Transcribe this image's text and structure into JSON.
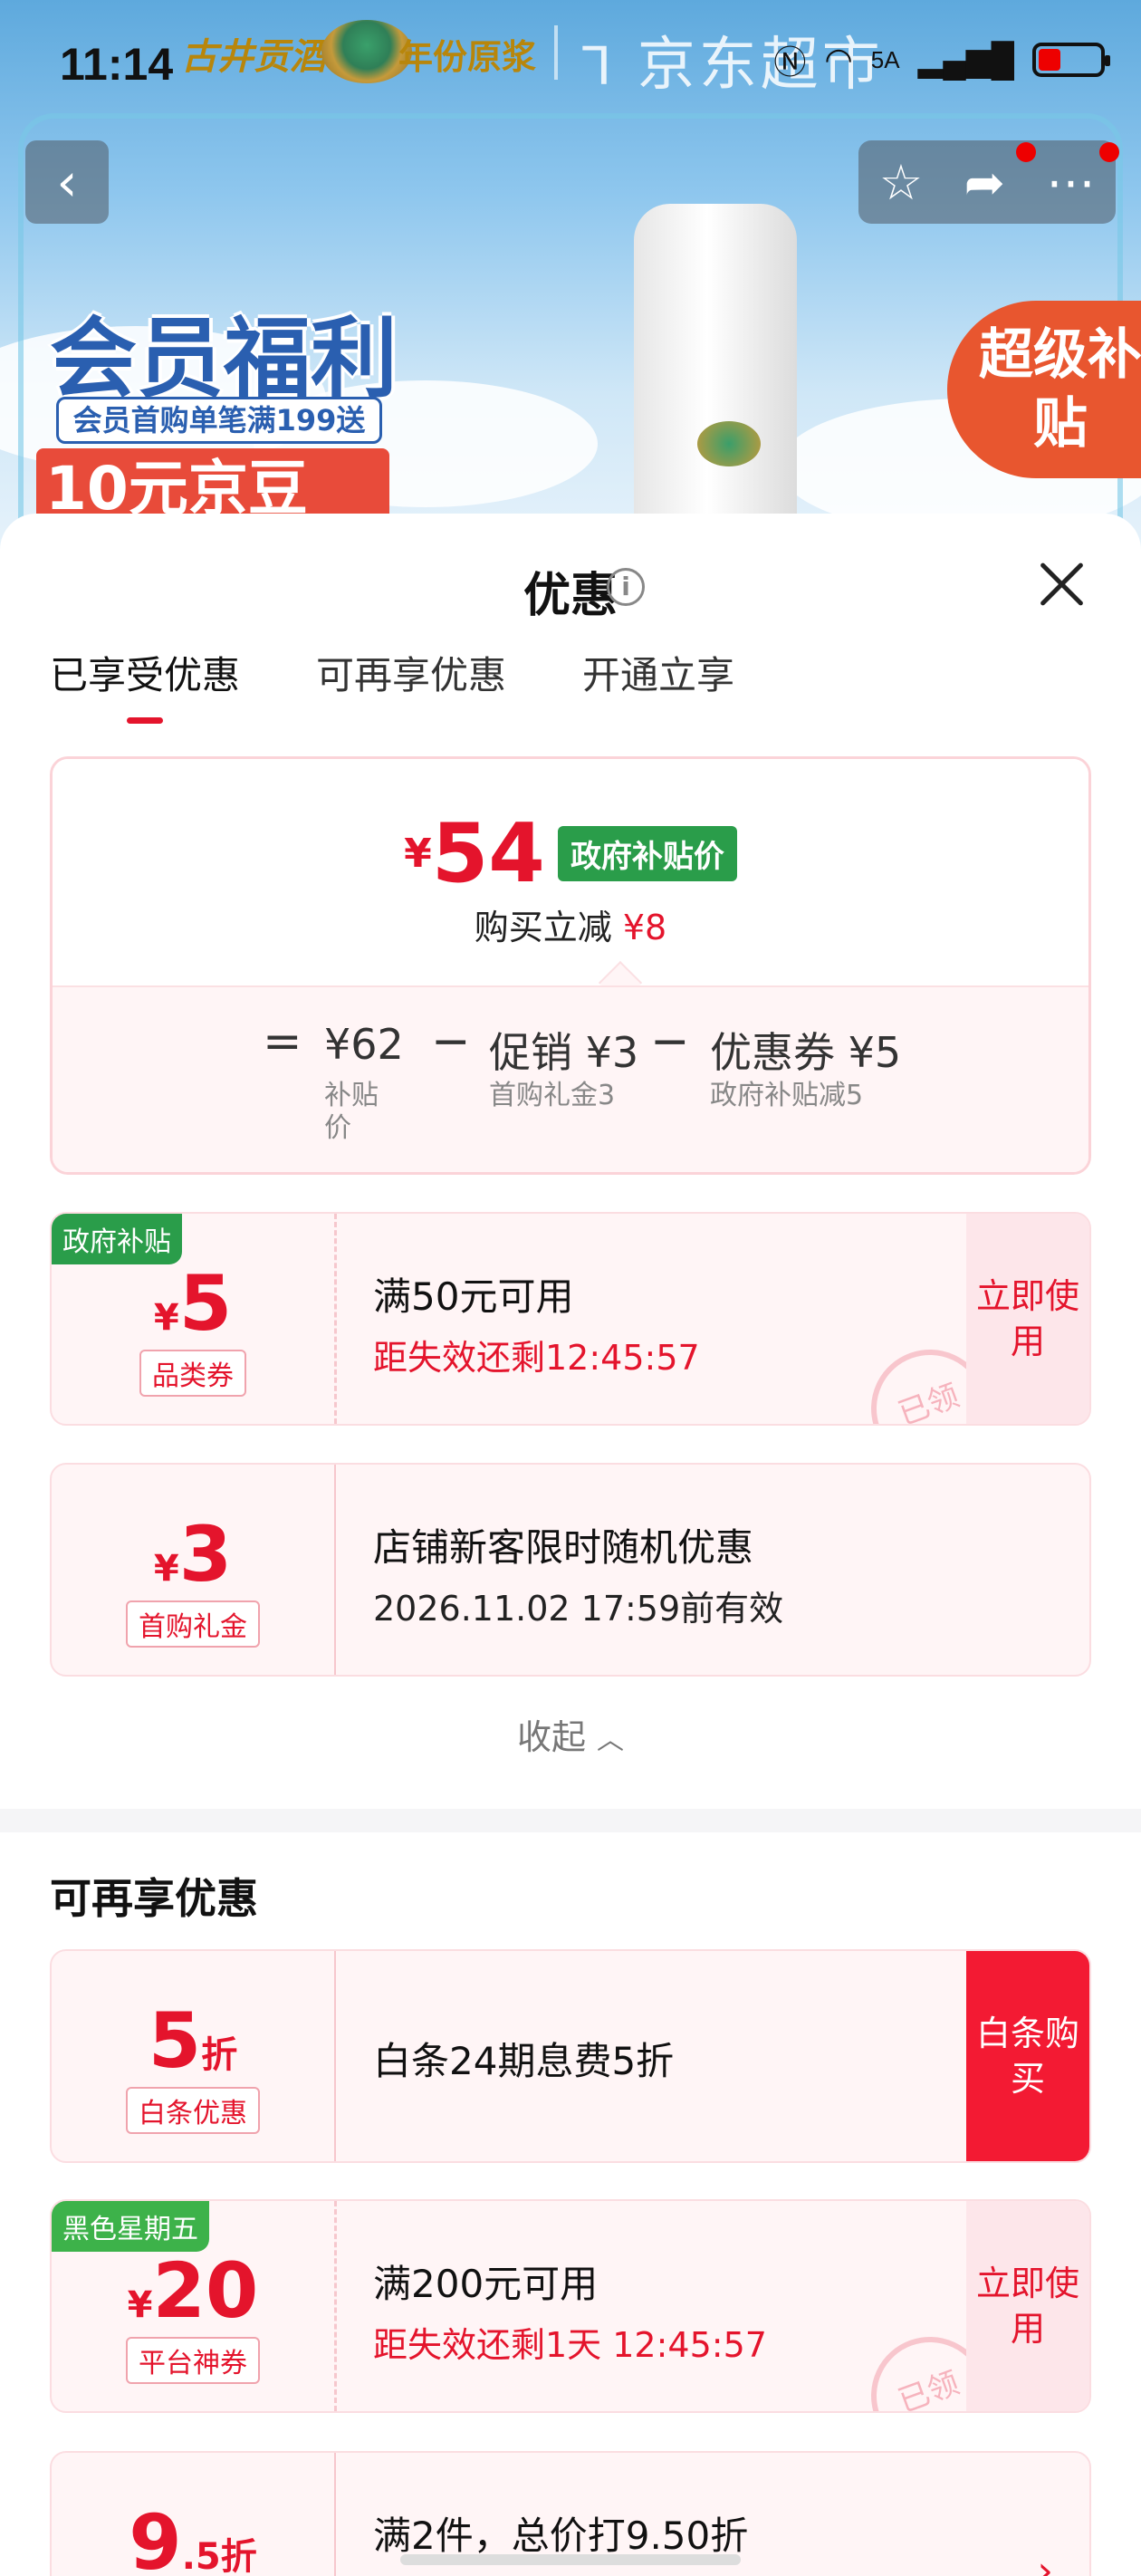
{
  "status_bar": {
    "time": "11:14",
    "brand_text": "古井贡酒",
    "brand_year": "年份原浆",
    "jd_supermarket": "京东超市",
    "network": "5A"
  },
  "banner": {
    "promo_title": "会员福利",
    "promo_sub": "会员首购单笔满199送",
    "promo_bean": "10元京豆",
    "super_subsidy": "超级补贴"
  },
  "sheet": {
    "title": "优惠",
    "tabs": [
      "已享受优惠",
      "可再享优惠",
      "开通立享"
    ],
    "active_tab": 0,
    "summary": {
      "currency": "¥",
      "price": "54",
      "price_tag": "政府补贴价",
      "instant_cut_label": "购买立减",
      "instant_cut_value": "¥8",
      "calc": {
        "eq": "=",
        "base_value": "¥62",
        "base_label": "补贴价",
        "minus1": "−",
        "promo_value": "促销 ¥3",
        "promo_label": "首购礼金3",
        "minus2": "−",
        "coupon_value": "优惠券 ¥5",
        "coupon_label": "政府补贴减5"
      }
    },
    "enjoyed_coupons": [
      {
        "corner_tag": "政府补贴",
        "currency": "¥",
        "amount": "5",
        "type": "品类券",
        "title": "满50元可用",
        "subtitle": "距失效还剩12:45:57",
        "action": "立即使用",
        "stamp": "已领"
      },
      {
        "currency": "¥",
        "amount": "3",
        "type": "首购礼金",
        "title": "店铺新客限时随机优惠",
        "subtitle": "2026.11.02 17:59前有效"
      }
    ],
    "collapse_label": "收起",
    "more_section_title": "可再享优惠",
    "more_coupons": [
      {
        "amount": "5",
        "suffix": "折",
        "type": "白条优惠",
        "title": "白条24期息费5折",
        "action": "白条购买"
      },
      {
        "corner_tag": "黑色星期五",
        "currency": "¥",
        "amount": "20",
        "type": "平台神券",
        "title": "满200元可用",
        "subtitle": "距失效还剩1天 12:45:57",
        "action": "立即使用",
        "stamp": "已领"
      },
      {
        "amount": "9",
        "suffix": ".5折",
        "title": "满2件，总价打9.50折",
        "arrow": "›"
      }
    ]
  },
  "colors": {
    "accent_red": "#e4142c",
    "gov_green": "#2a9d4a",
    "black_friday_green": "#3db24a"
  }
}
